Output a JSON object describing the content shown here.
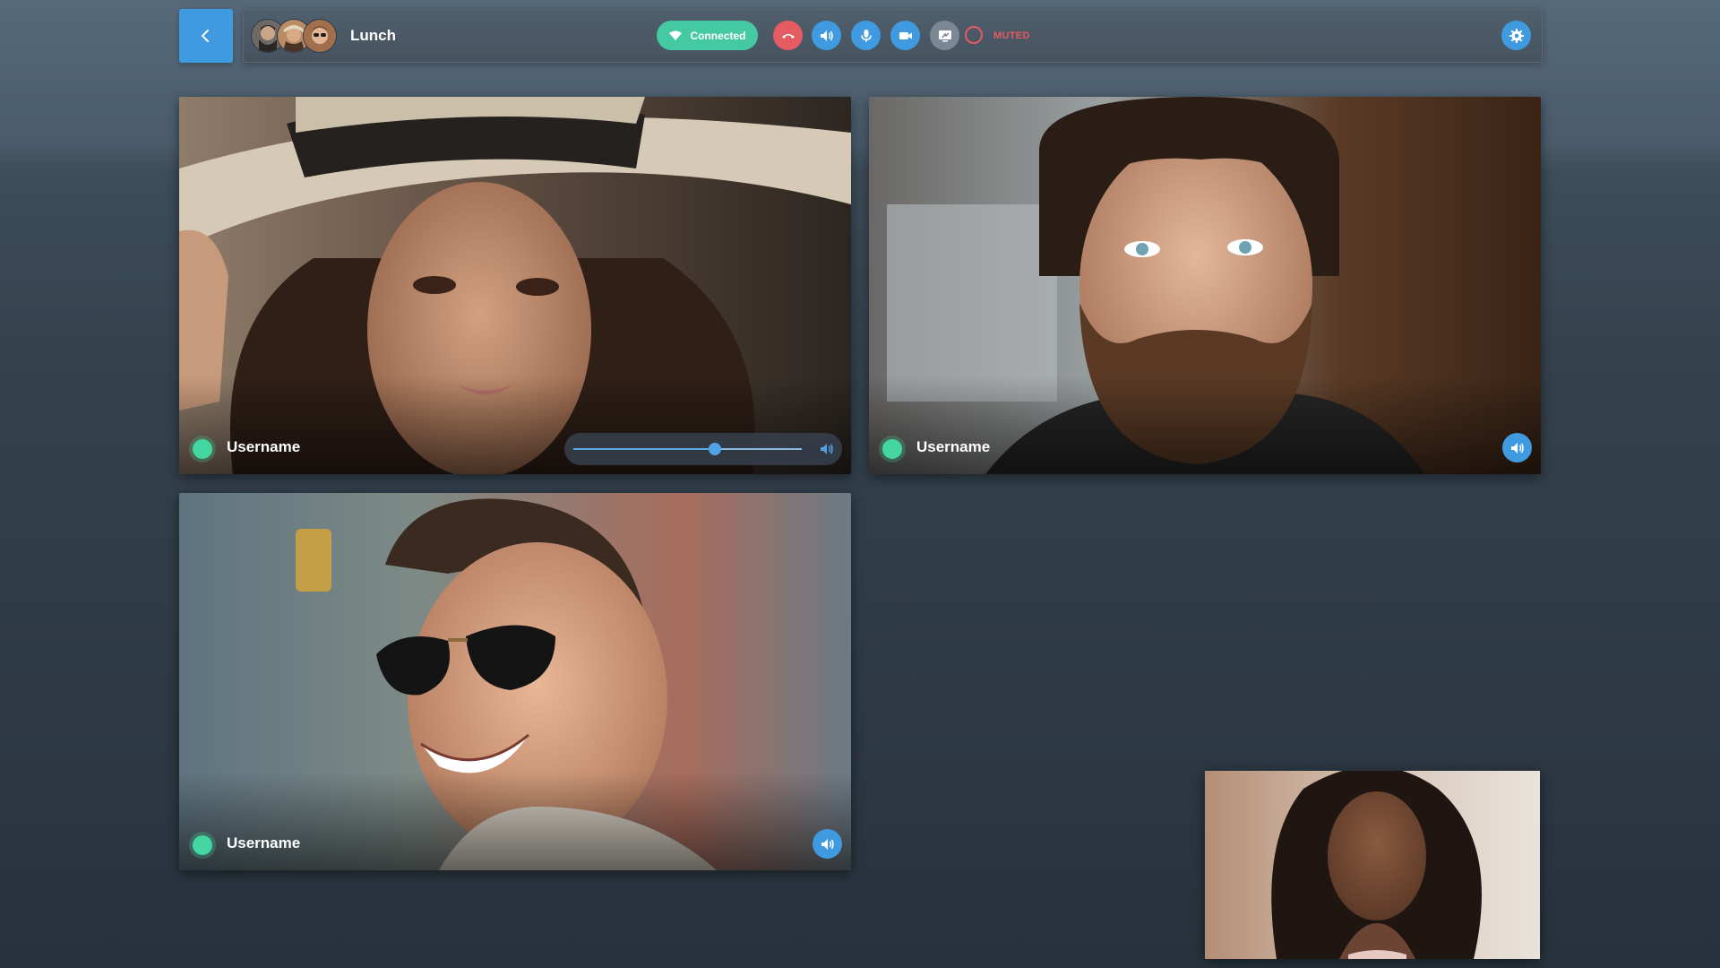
{
  "colors": {
    "accent": "#3f9ae0",
    "connected": "#44c9a3",
    "danger": "#e55b62",
    "online": "#44d6a0"
  },
  "toolbar": {
    "room_title": "Lunch",
    "status_label": "Connected",
    "muted_label": "MUTED",
    "icons": [
      "back-chevron-icon",
      "wifi-icon",
      "hang-up-icon",
      "speaker-icon",
      "microphone-icon",
      "camera-icon",
      "screen-share-icon",
      "record-icon",
      "gear-icon"
    ]
  },
  "participants": [
    {
      "username": "Username",
      "volume": 0.62,
      "online": true
    },
    {
      "username": "Username",
      "online": true
    },
    {
      "username": "Username",
      "online": true
    }
  ]
}
